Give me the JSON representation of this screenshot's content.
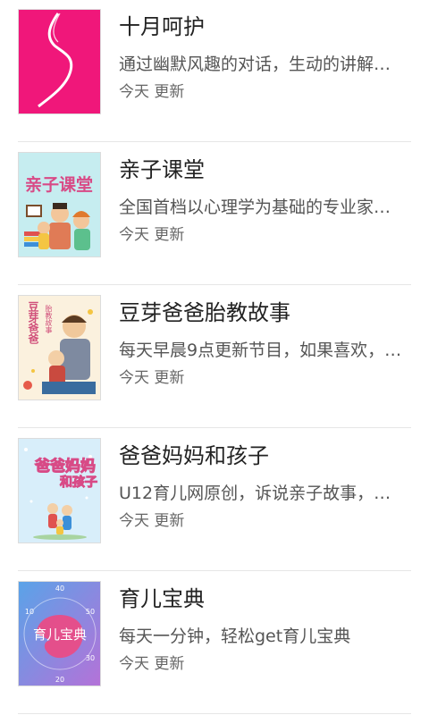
{
  "items": [
    {
      "title": "十月呵护",
      "description": "通过幽默风趣的对话，生动的讲解…",
      "updated": "今天 更新",
      "thumbnail_icon": "pregnant-silhouette-icon",
      "accent": "#f0177a"
    },
    {
      "title": "亲子课堂",
      "description": "全国首档以心理学为基础的专业家…",
      "updated": "今天 更新",
      "thumbnail_icon": "family-classroom-illustration",
      "accent": "#d84a86",
      "thumb_text": "亲子课堂"
    },
    {
      "title": "豆芽爸爸胎教故事",
      "description": "每天早晨9点更新节目，如果喜欢，…",
      "updated": "今天 更新",
      "thumbnail_icon": "father-child-illustration",
      "accent": "#f3c86b",
      "thumb_text": [
        "豆芽爸爸",
        "胎教故事"
      ]
    },
    {
      "title": "爸爸妈妈和孩子",
      "description": "U12育儿网原创，诉说亲子故事，…",
      "updated": "今天 更新",
      "thumbnail_icon": "family-cartoon-illustration",
      "accent": "#e86aa2",
      "thumb_text": [
        "爸爸妈妈",
        "和孩子"
      ]
    },
    {
      "title": "育儿宝典",
      "description": "每天一分钟，轻松get育儿宝典",
      "updated": "今天 更新",
      "thumbnail_icon": "baby-clock-icon",
      "accent": "#5aa3e8",
      "thumb_text": "育儿宝典",
      "clock_numbers": [
        "40",
        "50",
        "10",
        "30",
        "20"
      ]
    }
  ]
}
